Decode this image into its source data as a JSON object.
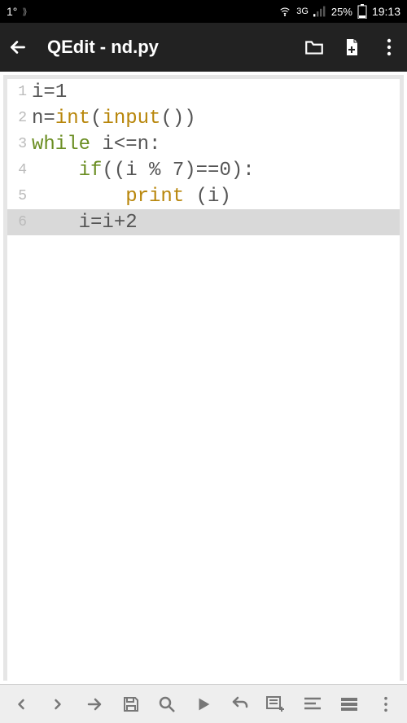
{
  "status": {
    "temp": "1°",
    "network": "3G",
    "battery": "25%",
    "time": "19:13"
  },
  "toolbar": {
    "title": "QEdit - nd.py"
  },
  "code": {
    "lines": [
      {
        "num": "1",
        "hl": false,
        "tokens": [
          {
            "t": "i=",
            "c": "txt"
          },
          {
            "t": "1",
            "c": "num"
          }
        ]
      },
      {
        "num": "2",
        "hl": false,
        "tokens": [
          {
            "t": "n=",
            "c": "txt"
          },
          {
            "t": "int",
            "c": "fn"
          },
          {
            "t": "(",
            "c": "txt"
          },
          {
            "t": "input",
            "c": "fn"
          },
          {
            "t": "())",
            "c": "txt"
          }
        ]
      },
      {
        "num": "3",
        "hl": false,
        "tokens": [
          {
            "t": "while",
            "c": "kw"
          },
          {
            "t": " i<=n:",
            "c": "txt"
          }
        ]
      },
      {
        "num": "4",
        "hl": false,
        "tokens": [
          {
            "t": "    ",
            "c": "txt"
          },
          {
            "t": "if",
            "c": "kw"
          },
          {
            "t": "((i % ",
            "c": "txt"
          },
          {
            "t": "7",
            "c": "num"
          },
          {
            "t": ")==",
            "c": "txt"
          },
          {
            "t": "0",
            "c": "num"
          },
          {
            "t": "):",
            "c": "txt"
          }
        ]
      },
      {
        "num": "5",
        "hl": false,
        "tokens": [
          {
            "t": "        ",
            "c": "txt"
          },
          {
            "t": "print",
            "c": "fn"
          },
          {
            "t": " (i)",
            "c": "txt"
          }
        ]
      },
      {
        "num": "6",
        "hl": true,
        "tokens": [
          {
            "t": "    i=i+",
            "c": "txt"
          },
          {
            "t": "2",
            "c": "num"
          }
        ]
      }
    ]
  }
}
